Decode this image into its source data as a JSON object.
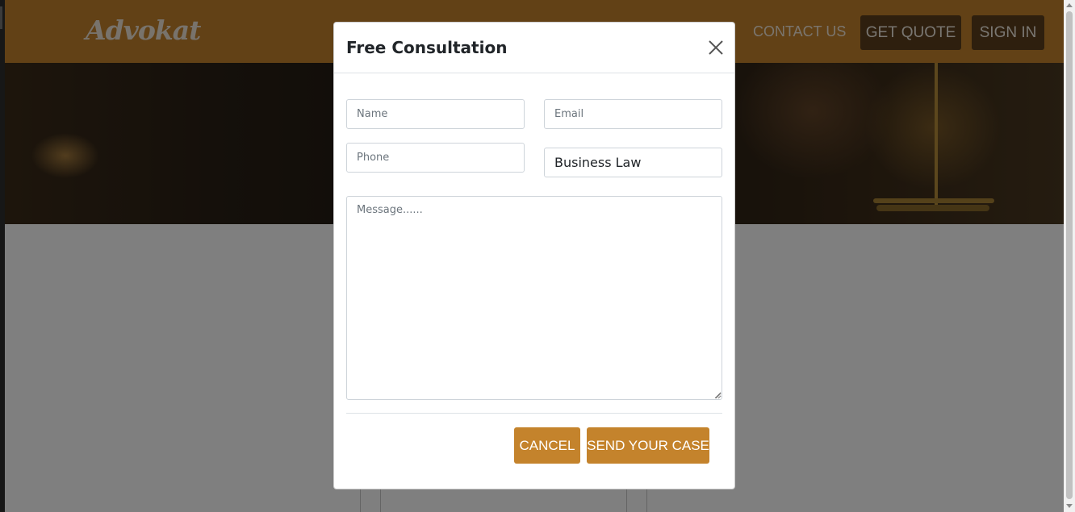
{
  "header": {
    "logo": "Advokat",
    "nav": {
      "contact_us": "CONTACT US"
    },
    "buttons": {
      "get_quote": "GET QUOTE",
      "sign_in": "SIGN IN"
    }
  },
  "modal": {
    "title": "Free Consultation",
    "fields": {
      "name_placeholder": "Name",
      "email_placeholder": "Email",
      "phone_placeholder": "Phone",
      "practice_area_selected": "Business Law",
      "message_placeholder": "Message......"
    },
    "buttons": {
      "cancel": "CANCEL",
      "send": "SEND YOUR CASE"
    }
  },
  "icons": {
    "close": "close-icon"
  },
  "colors": {
    "brand": "#c4832c",
    "header_button": "#5c3f1c"
  }
}
